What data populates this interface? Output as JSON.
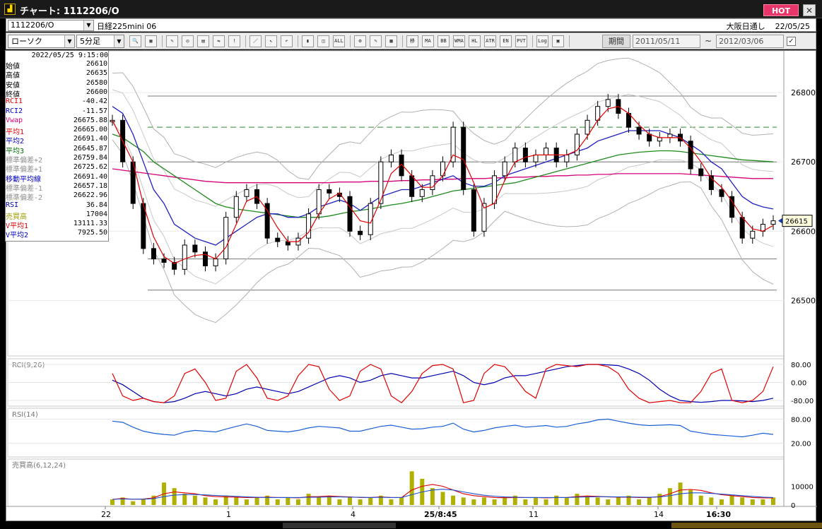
{
  "window": {
    "title": "チャート: 1112206/O",
    "hot_label": "HOT",
    "close_label": "✕",
    "app_icon": "chart-app-icon"
  },
  "infobar": {
    "code": "1112206/O",
    "name": "日経225mini 06",
    "session": "大阪日通し",
    "date": "22/05/25"
  },
  "toolbar": {
    "chart_type": "ローソク",
    "interval": "5分足",
    "period_label": "期間",
    "date_from": "2011/05/11",
    "date_to": "2012/03/06",
    "range_sep": "~",
    "buttons": [
      {
        "name": "zoom-icon",
        "label": "🔍"
      },
      {
        "name": "grid-icon",
        "label": "▦"
      },
      {
        "name": "tool1-icon",
        "label": "✎"
      },
      {
        "name": "tool2-icon",
        "label": "◎"
      },
      {
        "name": "tool3-icon",
        "label": "▤"
      },
      {
        "name": "tool4-icon",
        "label": "⇋"
      },
      {
        "name": "tool5-icon",
        "label": "!"
      },
      {
        "name": "line-draw-icon",
        "label": "／"
      },
      {
        "name": "cursor-icon",
        "label": "↖"
      },
      {
        "name": "undo-icon",
        "label": "↶"
      },
      {
        "name": "candle-icon",
        "label": "▮"
      },
      {
        "name": "candle2-icon",
        "label": "◫"
      },
      {
        "name": "all-icon",
        "label": "ALL"
      },
      {
        "name": "settings-icon",
        "label": "⚙"
      },
      {
        "name": "wrench-icon",
        "label": "✎"
      },
      {
        "name": "color-icon",
        "label": "▩"
      },
      {
        "name": "ma-icon",
        "label": "移"
      },
      {
        "name": "ma2-icon",
        "label": "MA"
      },
      {
        "name": "bb-icon",
        "label": "BB"
      },
      {
        "name": "wma-icon",
        "label": "WMA"
      },
      {
        "name": "hl-icon",
        "label": "HL"
      },
      {
        "name": "atr-icon",
        "label": "ATR"
      },
      {
        "name": "envelope-icon",
        "label": "EN"
      },
      {
        "name": "pvt-icon",
        "label": "PVT"
      },
      {
        "name": "log-icon",
        "label": "Log"
      },
      {
        "name": "export-icon",
        "label": "▣"
      }
    ]
  },
  "info_panel": {
    "datetime": "2022/05/25 9:15:00",
    "rows": [
      {
        "label": "始値",
        "value": "26610",
        "color": "#000000"
      },
      {
        "label": "高値",
        "value": "26635",
        "color": "#000000"
      },
      {
        "label": "安値",
        "value": "26580",
        "color": "#000000"
      },
      {
        "label": "終値",
        "value": "26600",
        "color": "#000000"
      },
      {
        "label": "RCI1",
        "value": "-40.42",
        "color": "#e00000"
      },
      {
        "label": "RCI2",
        "value": "-11.57",
        "color": "#0000c0"
      },
      {
        "label": "Vwap",
        "value": "26675.88",
        "color": "#e0007a"
      },
      {
        "label": "平均1",
        "value": "26665.00",
        "color": "#e00000"
      },
      {
        "label": "平均2",
        "value": "26691.40",
        "color": "#0000c0"
      },
      {
        "label": "平均3",
        "value": "26645.87",
        "color": "#007000"
      },
      {
        "label": "標準偏差+2",
        "value": "26759.84",
        "color": "#909090"
      },
      {
        "label": "標準偏差+1",
        "value": "26725.62",
        "color": "#909090"
      },
      {
        "label": "移動平均線",
        "value": "26691.40",
        "color": "#0000c0"
      },
      {
        "label": "標準偏差-1",
        "value": "26657.18",
        "color": "#909090"
      },
      {
        "label": "標準偏差-2",
        "value": "26622.96",
        "color": "#909090"
      },
      {
        "label": "RSI",
        "value": "36.84",
        "color": "#0000c0"
      },
      {
        "label": "売買高",
        "value": "17004",
        "color": "#a0a000"
      },
      {
        "label": "V平均1",
        "value": "13111.33",
        "color": "#e00000"
      },
      {
        "label": "V平均2",
        "value": "7925.50",
        "color": "#0000c0"
      }
    ]
  },
  "chart": {
    "price_ticks": [
      "26800",
      "26700",
      "26600",
      "26500"
    ],
    "current_price": "26615",
    "rci_title": "RCI(9,26)",
    "rci_ticks": [
      "80.00",
      "0.00",
      "-80.00"
    ],
    "rsi_title": "RSI(14)",
    "rsi_ticks": [
      "80.00",
      "20.00"
    ],
    "vol_title": "売買高(6,12,24)",
    "vol_ticks": [
      "10000",
      "0"
    ],
    "x_labels": [
      "22",
      "1",
      "4",
      "25/8:45",
      "11",
      "14",
      "16:30"
    ]
  },
  "chart_data": {
    "type": "line",
    "title": "日経225mini 06",
    "price_range": [
      26420,
      26850
    ],
    "x_labels": [
      "22",
      "1",
      "4",
      "25/8:45",
      "11",
      "14",
      "16:30"
    ],
    "close": [
      26760,
      26700,
      26640,
      26575,
      26560,
      26555,
      26545,
      26580,
      26570,
      26550,
      26560,
      26620,
      26650,
      26660,
      26640,
      26590,
      26585,
      26580,
      26590,
      26625,
      26660,
      26655,
      26650,
      26600,
      26595,
      26640,
      26700,
      26710,
      26680,
      26650,
      26660,
      26680,
      26700,
      26750,
      26660,
      26600,
      26640,
      26680,
      26700,
      26720,
      26700,
      26710,
      26720,
      26700,
      26710,
      26740,
      26760,
      26780,
      26790,
      26770,
      26750,
      26740,
      26730,
      26735,
      26740,
      26730,
      26690,
      26680,
      26660,
      26650,
      26620,
      26590,
      26600,
      26610,
      26615
    ],
    "sma20": [
      26780,
      26770,
      26740,
      26700,
      26660,
      26640,
      26610,
      26600,
      26590,
      26585,
      26580,
      26590,
      26600,
      26610,
      26620,
      26625,
      26625,
      26620,
      26620,
      26625,
      26635,
      26640,
      26645,
      26640,
      26630,
      26640,
      26650,
      26655,
      26660,
      26660,
      26665,
      26670,
      26675,
      26680,
      26670,
      26665,
      26665,
      26670,
      26680,
      26685,
      26690,
      26695,
      26700,
      26705,
      26710,
      26715,
      26720,
      26730,
      26735,
      26740,
      26745,
      26745,
      26745,
      26745,
      26740,
      26735,
      26725,
      26715,
      26700,
      26690,
      26670,
      26650,
      26640,
      26635,
      26632
    ],
    "sma60": [
      26740,
      26735,
      26725,
      26715,
      26700,
      26690,
      26680,
      26670,
      26660,
      26650,
      26640,
      26635,
      26632,
      26630,
      26628,
      26626,
      26624,
      26622,
      26620,
      26620,
      26620,
      26622,
      26625,
      26628,
      26630,
      26632,
      26635,
      26638,
      26640,
      26643,
      26646,
      26650,
      26654,
      26658,
      26660,
      26662,
      26664,
      26666,
      26668,
      26670,
      26674,
      26678,
      26682,
      26686,
      26690,
      26694,
      26698,
      26702,
      26706,
      26710,
      26712,
      26714,
      26715,
      26716,
      26716,
      26715,
      26713,
      26711,
      26709,
      26707,
      26705,
      26703,
      26702,
      26701,
      26700
    ],
    "vwap": [
      26690,
      26688,
      26686,
      26684,
      26682,
      26680,
      26678,
      26676,
      26674,
      26672,
      26671,
      26670,
      26670,
      26670,
      26670,
      26670,
      26670,
      26670,
      26670,
      26670,
      26670,
      26670,
      26671,
      26671,
      26671,
      26672,
      26672,
      26672,
      26673,
      26673,
      26674,
      26674,
      26675,
      26675,
      26676,
      26676,
      26676,
      26677,
      26677,
      26678,
      26678,
      26679,
      26679,
      26680,
      26680,
      26681,
      26681,
      26682,
      26682,
      26683,
      26683,
      26683,
      26683,
      26683,
      26683,
      26683,
      26682,
      26681,
      26680,
      26679,
      26678,
      26677,
      26676,
      26676,
      26676
    ],
    "rci1": [
      40,
      -60,
      -80,
      -70,
      -85,
      -90,
      -60,
      40,
      60,
      0,
      -80,
      -70,
      50,
      80,
      20,
      -70,
      -80,
      -60,
      30,
      80,
      70,
      -30,
      -80,
      -60,
      50,
      80,
      60,
      -60,
      -90,
      -40,
      40,
      75,
      80,
      60,
      -90,
      -80,
      40,
      80,
      70,
      20,
      -40,
      -70,
      60,
      80,
      75,
      70,
      80,
      80,
      70,
      40,
      -30,
      -70,
      -90,
      -85,
      -80,
      -90,
      -90,
      -40,
      40,
      60,
      -80,
      -90,
      -80,
      -40,
      70
    ],
    "rci2": [
      10,
      -10,
      -40,
      -70,
      -85,
      -90,
      -85,
      -70,
      -50,
      -40,
      -50,
      -60,
      -50,
      -30,
      -20,
      -30,
      -40,
      -50,
      -40,
      -20,
      0,
      20,
      30,
      20,
      0,
      10,
      30,
      40,
      30,
      20,
      20,
      30,
      40,
      50,
      30,
      0,
      -10,
      0,
      20,
      30,
      30,
      40,
      50,
      60,
      70,
      75,
      80,
      80,
      78,
      75,
      60,
      40,
      10,
      -30,
      -60,
      -80,
      -85,
      -88,
      -85,
      -80,
      -80,
      -82,
      -85,
      -80,
      -70
    ],
    "rsi": [
      75,
      72,
      60,
      50,
      45,
      42,
      40,
      48,
      52,
      50,
      48,
      55,
      62,
      68,
      62,
      52,
      50,
      48,
      52,
      58,
      62,
      60,
      58,
      50,
      50,
      56,
      62,
      65,
      60,
      55,
      56,
      60,
      62,
      70,
      55,
      48,
      52,
      58,
      62,
      65,
      60,
      62,
      64,
      60,
      62,
      68,
      72,
      78,
      80,
      75,
      70,
      66,
      64,
      65,
      66,
      64,
      50,
      46,
      42,
      40,
      38,
      36,
      40,
      45,
      42
    ],
    "volume": [
      3,
      4,
      2,
      3,
      5,
      12,
      9,
      6,
      5,
      4,
      3,
      5,
      4,
      3,
      4,
      5,
      3,
      4,
      3,
      6,
      4,
      5,
      3,
      4,
      3,
      4,
      5,
      3,
      4,
      18,
      14,
      9,
      7,
      5,
      4,
      3,
      4,
      3,
      4,
      5,
      3,
      4,
      3,
      5,
      4,
      6,
      5,
      4,
      3,
      4,
      5,
      3,
      4,
      6,
      9,
      12,
      8,
      5,
      4,
      3,
      5,
      4,
      3,
      3,
      4
    ],
    "vol_ma1": [
      3,
      3.5,
      3,
      3.2,
      3.8,
      6,
      7,
      6.5,
      6,
      5,
      4.5,
      4.3,
      4.2,
      4,
      4,
      4.2,
      4,
      4,
      3.8,
      4.4,
      4.5,
      4.8,
      4.5,
      4.3,
      4,
      4,
      4.3,
      4,
      4,
      8,
      10,
      11,
      10,
      8,
      6,
      5,
      4.5,
      4,
      3.9,
      4,
      4,
      4,
      3.8,
      4,
      4,
      4.5,
      4.8,
      4.6,
      4.3,
      4.2,
      4.2,
      4,
      4,
      4.5,
      6,
      8,
      8.3,
      7.8,
      6.5,
      5.5,
      5,
      4.5,
      4,
      3.8,
      3.8
    ],
    "vol_ma2": [
      3,
      3.2,
      3.1,
      3.1,
      3.4,
      4.5,
      5.3,
      5.6,
      5.6,
      5.4,
      5.1,
      4.9,
      4.6,
      4.3,
      4.1,
      4,
      4,
      4,
      4,
      4.1,
      4.2,
      4.3,
      4.3,
      4.2,
      4.1,
      4,
      4.1,
      4,
      4,
      5.5,
      7,
      8,
      8.4,
      8,
      7,
      6,
      5.2,
      4.7,
      4.3,
      4.1,
      4,
      4,
      4,
      4,
      4,
      4.2,
      4.3,
      4.4,
      4.4,
      4.3,
      4.3,
      4.2,
      4.1,
      4.3,
      5,
      6,
      6.5,
      6.5,
      6.2,
      5.8,
      5.4,
      5,
      4.6,
      4.2,
      4
    ]
  }
}
